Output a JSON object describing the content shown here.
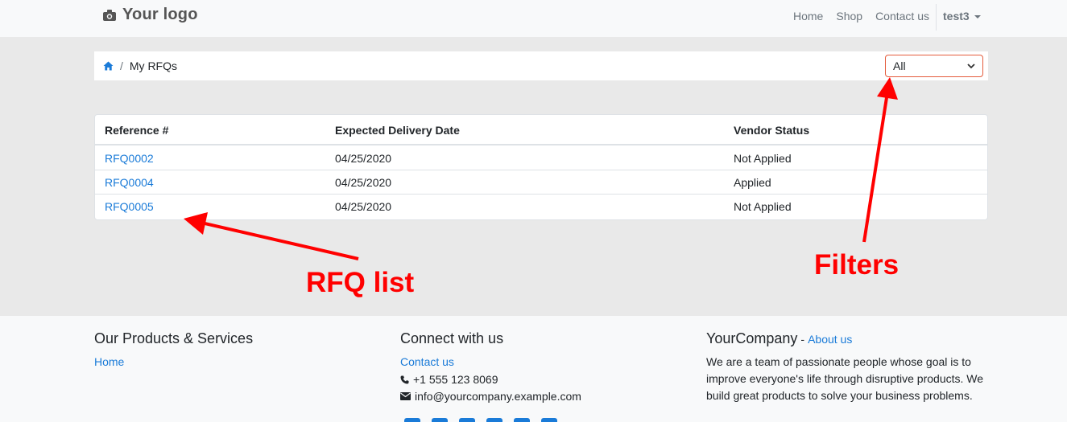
{
  "header": {
    "logo_text": "Your logo",
    "nav": [
      "Home",
      "Shop",
      "Contact us"
    ],
    "user": "test3"
  },
  "breadcrumb": {
    "home_icon": "home-icon",
    "separator": "/",
    "current": "My RFQs"
  },
  "filter": {
    "selected": "All"
  },
  "table": {
    "headers": [
      "Reference #",
      "Expected Delivery Date",
      "Vendor Status"
    ],
    "rows": [
      {
        "ref": "RFQ0002",
        "date": "04/25/2020",
        "status": "Not Applied"
      },
      {
        "ref": "RFQ0004",
        "date": "04/25/2020",
        "status": "Applied"
      },
      {
        "ref": "RFQ0005",
        "date": "04/25/2020",
        "status": "Not Applied"
      }
    ]
  },
  "annotations": {
    "rfq_list": "RFQ list",
    "filters": "Filters",
    "color": "#ff0000"
  },
  "footer": {
    "col1": {
      "title": "Our Products & Services",
      "links": [
        "Home"
      ]
    },
    "col2": {
      "title": "Connect with us",
      "contact_link": "Contact us",
      "phone": "+1 555 123 8069",
      "email": "info@yourcompany.example.com"
    },
    "col3": {
      "title": "YourCompany",
      "dash": "-",
      "about_link": "About us",
      "text": "We are a team of passionate people whose goal is to improve everyone's life through disruptive products. We build great products to solve your business problems."
    }
  },
  "colors": {
    "link": "#1a7bd8",
    "select_border": "#e45c3c",
    "header_bg": "#f8f9fa",
    "body_bg": "#e9e9e9"
  }
}
